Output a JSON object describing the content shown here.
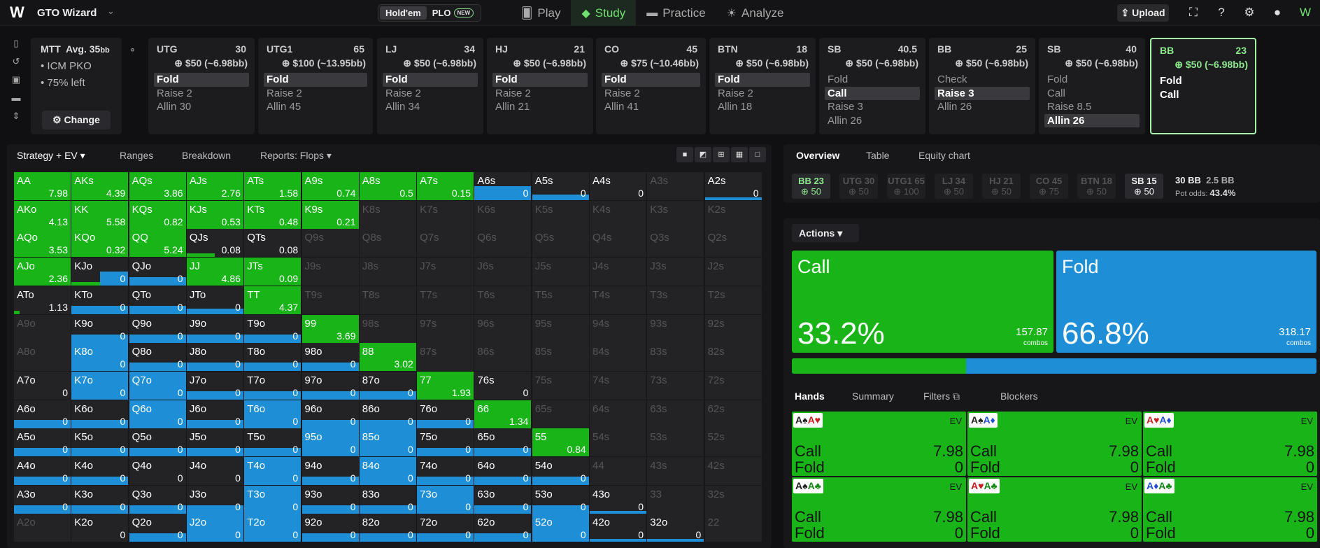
{
  "app": {
    "name": "GTO Wizard",
    "game_tabs": [
      "Hold'em",
      "PLO"
    ],
    "new_badge": "NEW",
    "nav": [
      {
        "label": "Play",
        "icon": "cards-icon"
      },
      {
        "label": "Study",
        "icon": "mortarboard-icon"
      },
      {
        "label": "Practice",
        "icon": "gamepad-icon"
      },
      {
        "label": "Analyze",
        "icon": "lightbulb-icon"
      }
    ],
    "upload": "Upload"
  },
  "colors": {
    "raise_green": "#18b418",
    "fold_blue": "#1e8fd6",
    "active_green": "#6fe16f"
  },
  "mtt": {
    "title": "MTT",
    "avg": "Avg. 35",
    "avg_unit": "bb",
    "items": [
      "ICM PKO",
      "75% left"
    ],
    "change": "Change"
  },
  "positions": [
    {
      "name": "UTG",
      "stack": "30",
      "bounty": "$50 (~6.98bb)",
      "actions": [
        "Fold",
        "Raise 2",
        "Allin 30"
      ],
      "sel": 0
    },
    {
      "name": "UTG1",
      "stack": "65",
      "bounty": "$100 (~13.95bb)",
      "actions": [
        "Fold",
        "Raise 2",
        "Allin 45"
      ],
      "sel": 0
    },
    {
      "name": "LJ",
      "stack": "34",
      "bounty": "$50 (~6.98bb)",
      "actions": [
        "Fold",
        "Raise 2",
        "Allin 34"
      ],
      "sel": 0
    },
    {
      "name": "HJ",
      "stack": "21",
      "bounty": "$50 (~6.98bb)",
      "actions": [
        "Fold",
        "Raise 2",
        "Allin 21"
      ],
      "sel": 0
    },
    {
      "name": "CO",
      "stack": "45",
      "bounty": "$75 (~10.46bb)",
      "actions": [
        "Fold",
        "Raise 2",
        "Allin 41"
      ],
      "sel": 0
    },
    {
      "name": "BTN",
      "stack": "18",
      "bounty": "$50 (~6.98bb)",
      "actions": [
        "Fold",
        "Raise 2",
        "Allin 18"
      ],
      "sel": 0
    },
    {
      "name": "SB",
      "stack": "40.5",
      "bounty": "$50 (~6.98bb)",
      "actions": [
        "Fold",
        "Call",
        "Raise 3",
        "Allin 26"
      ],
      "sel": 1
    },
    {
      "name": "BB",
      "stack": "25",
      "bounty": "$50 (~6.98bb)",
      "actions": [
        "Check",
        "Raise 3",
        "Allin 26"
      ],
      "sel": 1
    },
    {
      "name": "SB",
      "stack": "40",
      "bounty": "$50 (~6.98bb)",
      "actions": [
        "Fold",
        "Call",
        "Raise 8.5",
        "Allin 26"
      ],
      "sel": 3
    },
    {
      "name": "BB",
      "stack": "23",
      "bounty": "$50 (~6.98bb)",
      "actions": [
        "Fold",
        "Call"
      ],
      "sel": -1
    }
  ],
  "left_tabs": [
    "Strategy + EV",
    "Ranges",
    "Breakdown",
    "Reports: Flops"
  ],
  "matrix": {
    "ranks": [
      "A",
      "K",
      "Q",
      "J",
      "T",
      "9",
      "8",
      "7",
      "6",
      "5",
      "4",
      "3",
      "2"
    ],
    "cells": {
      "AA": [
        7.98,
        1,
        0
      ],
      "AKs": [
        4.39,
        1,
        0
      ],
      "AQs": [
        3.86,
        1,
        0
      ],
      "AJs": [
        2.76,
        1,
        0
      ],
      "ATs": [
        1.58,
        1,
        0
      ],
      "A9s": [
        0.74,
        1,
        0
      ],
      "A8s": [
        0.5,
        1,
        0
      ],
      "A7s": [
        0.15,
        1,
        0
      ],
      "A6s": [
        0,
        0,
        0.5
      ],
      "A5s": [
        0,
        0,
        0.2
      ],
      "A4s": [
        0,
        0,
        0
      ],
      "A2s": [
        0,
        0,
        0.1
      ],
      "AKo": [
        4.13,
        1,
        0
      ],
      "KK": [
        5.58,
        1,
        0
      ],
      "KQs": [
        0.82,
        1,
        0
      ],
      "KJs": [
        0.53,
        1,
        0
      ],
      "KTs": [
        0.48,
        1,
        0
      ],
      "K9s": [
        0.21,
        1,
        0
      ],
      "AQo": [
        3.53,
        1,
        0
      ],
      "KQo": [
        0.32,
        1,
        0
      ],
      "QQ": [
        5.24,
        1,
        0
      ],
      "QJs": [
        0.08,
        0.5,
        0
      ],
      "QTs": [
        0.08,
        0,
        0
      ],
      "AJo": [
        2.36,
        1,
        0
      ],
      "KJo": [
        0,
        0.5,
        0.5
      ],
      "QJo": [
        0,
        0,
        0.3
      ],
      "JJ": [
        4.86,
        1,
        0
      ],
      "JTs": [
        0.09,
        1,
        0
      ],
      "ATo": [
        1.13,
        0.1,
        0
      ],
      "KTo": [
        0,
        0,
        0.3
      ],
      "QTo": [
        0,
        0,
        0.3
      ],
      "JTo": [
        0,
        0,
        0.2
      ],
      "TT": [
        4.37,
        1,
        0
      ],
      "K9o": [
        0,
        0,
        0.3
      ],
      "Q9o": [
        0,
        0,
        0.3
      ],
      "J9o": [
        0,
        0,
        0.3
      ],
      "T9o": [
        0,
        0,
        0.3
      ],
      "99": [
        3.69,
        1,
        0
      ],
      "K8o": [
        0,
        0,
        1
      ],
      "Q8o": [
        0,
        0,
        0.3
      ],
      "J8o": [
        0,
        0,
        0.3
      ],
      "T8o": [
        0,
        0,
        0.3
      ],
      "98o": [
        0,
        0,
        0.3
      ],
      "88": [
        3.02,
        1,
        0
      ],
      "A7o": [
        0,
        0,
        0
      ],
      "K7o": [
        0,
        0,
        1
      ],
      "Q7o": [
        0,
        0,
        1
      ],
      "J7o": [
        0,
        0,
        0.3
      ],
      "T7o": [
        0,
        0,
        0.3
      ],
      "97o": [
        0,
        0,
        0.3
      ],
      "87o": [
        0,
        0,
        0.3
      ],
      "77": [
        1.93,
        1,
        0
      ],
      "76s": [
        0,
        0,
        0
      ],
      "A6o": [
        0,
        0,
        0.3
      ],
      "K6o": [
        0,
        0,
        0.3
      ],
      "Q6o": [
        0,
        0,
        1
      ],
      "J6o": [
        0,
        0,
        0.3
      ],
      "T6o": [
        0,
        0,
        1
      ],
      "96o": [
        0,
        0,
        0.3
      ],
      "86o": [
        0,
        0,
        0.3
      ],
      "76o": [
        0,
        0,
        0.3
      ],
      "66": [
        1.34,
        1,
        0
      ],
      "A5o": [
        0,
        0,
        0.3
      ],
      "K5o": [
        0,
        0,
        0.3
      ],
      "Q5o": [
        0,
        0,
        0.3
      ],
      "J5o": [
        0,
        0,
        0.3
      ],
      "T5o": [
        0,
        0,
        0.3
      ],
      "95o": [
        0,
        0,
        1
      ],
      "85o": [
        0,
        0,
        1
      ],
      "75o": [
        0,
        0,
        0.3
      ],
      "65o": [
        0,
        0,
        0.3
      ],
      "55": [
        0.84,
        1,
        0
      ],
      "A4o": [
        0,
        0,
        0.3
      ],
      "K4o": [
        0,
        0,
        0.3
      ],
      "Q4o": [
        0,
        0,
        0
      ],
      "J4o": [
        0,
        0,
        0
      ],
      "T4o": [
        0,
        0,
        1
      ],
      "94o": [
        0,
        0,
        0.3
      ],
      "84o": [
        0,
        0,
        1
      ],
      "74o": [
        0,
        0,
        0.3
      ],
      "64o": [
        0,
        0,
        0.3
      ],
      "54o": [
        0,
        0,
        0.3
      ],
      "A3o": [
        0,
        0,
        0.3
      ],
      "K3o": [
        0,
        0,
        0.3
      ],
      "Q3o": [
        0,
        0,
        0.3
      ],
      "J3o": [
        0,
        0,
        0.3
      ],
      "T3o": [
        0,
        0,
        1
      ],
      "93o": [
        0,
        0,
        0.3
      ],
      "83o": [
        0,
        0,
        0.3
      ],
      "73o": [
        0,
        0,
        1
      ],
      "63o": [
        0,
        0,
        0.3
      ],
      "53o": [
        0,
        0,
        0.3
      ],
      "43o": [
        0,
        0,
        0.1
      ],
      "K2o": [
        0,
        0,
        0
      ],
      "Q2o": [
        0,
        0,
        0.3
      ],
      "J2o": [
        0,
        0,
        1
      ],
      "T2o": [
        0,
        0,
        1
      ],
      "92o": [
        0,
        0,
        0.3
      ],
      "82o": [
        0,
        0,
        0.3
      ],
      "72o": [
        0,
        0,
        0.3
      ],
      "62o": [
        0,
        0,
        0.3
      ],
      "52o": [
        0,
        0,
        1
      ],
      "42o": [
        0,
        0,
        0.1
      ],
      "32o": [
        0,
        0,
        0.1
      ]
    }
  },
  "overview": {
    "tabs": [
      "Overview",
      "Table",
      "Equity chart"
    ],
    "stacks": [
      {
        "p": "BB 23",
        "b": "50"
      },
      {
        "p": "UTG 30",
        "b": "50"
      },
      {
        "p": "UTG1 65",
        "b": "100"
      },
      {
        "p": "LJ 34",
        "b": "50"
      },
      {
        "p": "HJ 21",
        "b": "50"
      },
      {
        "p": "CO 45",
        "b": "75"
      },
      {
        "p": "BTN 18",
        "b": "50"
      },
      {
        "p": "SB 15",
        "b": "50"
      }
    ],
    "pot": "30 BB",
    "pot2": "2.5 BB",
    "pot_odds_label": "Pot odds:",
    "pot_odds": "43.4%"
  },
  "actions": {
    "label": "Actions",
    "call": {
      "label": "Call",
      "pct": "33.2%",
      "combos": "157.87",
      "unit": "combos"
    },
    "fold": {
      "label": "Fold",
      "pct": "66.8%",
      "combos": "318.17",
      "unit": "combos"
    },
    "call_fraction": 0.332
  },
  "hands": {
    "tabs": [
      "Hands",
      "Summary",
      "Filters",
      "Blockers"
    ],
    "combos": [
      {
        "c1": "A♠",
        "c2": "A♥",
        "call": "7.98",
        "fold": "0"
      },
      {
        "c1": "A♠",
        "c2": "A♦",
        "call": "7.98",
        "fold": "0"
      },
      {
        "c1": "A♥",
        "c2": "A♦",
        "call": "7.98",
        "fold": "0"
      },
      {
        "c1": "A♠",
        "c2": "A♣",
        "call": "7.98",
        "fold": "0"
      },
      {
        "c1": "A♥",
        "c2": "A♣",
        "call": "7.98",
        "fold": "0"
      },
      {
        "c1": "A♦",
        "c2": "A♣",
        "call": "7.98",
        "fold": "0"
      }
    ],
    "ev": "EV",
    "call": "Call",
    "fold": "Fold"
  }
}
